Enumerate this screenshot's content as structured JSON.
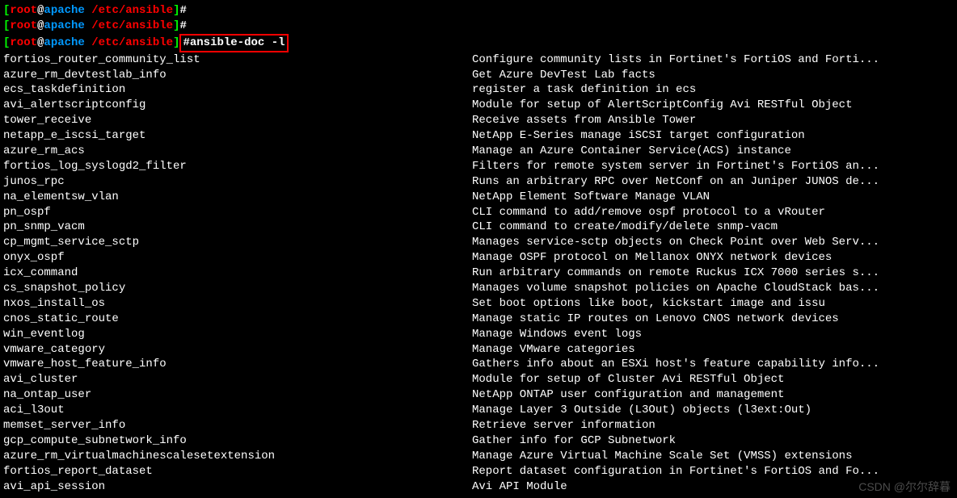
{
  "prompt": {
    "bracket_open": "[",
    "user": "root",
    "at": "@",
    "host": "apache",
    "path": " /etc/ansible",
    "bracket_close": "]",
    "hash": "#"
  },
  "command": "ansible-doc -l",
  "modules": [
    {
      "name": "fortios_router_community_list",
      "desc": "Configure community lists in Fortinet's FortiOS and Forti..."
    },
    {
      "name": "azure_rm_devtestlab_info",
      "desc": "Get Azure DevTest Lab facts"
    },
    {
      "name": "ecs_taskdefinition",
      "desc": "register a task definition in ecs"
    },
    {
      "name": "avi_alertscriptconfig",
      "desc": "Module for setup of AlertScriptConfig Avi RESTful Object"
    },
    {
      "name": "tower_receive",
      "desc": "Receive assets from Ansible Tower"
    },
    {
      "name": "netapp_e_iscsi_target",
      "desc": "NetApp E-Series manage iSCSI target configuration"
    },
    {
      "name": "azure_rm_acs",
      "desc": "Manage an Azure Container Service(ACS) instance"
    },
    {
      "name": "fortios_log_syslogd2_filter",
      "desc": "Filters for remote system server in Fortinet's FortiOS an..."
    },
    {
      "name": "junos_rpc",
      "desc": "Runs an arbitrary RPC over NetConf on an Juniper JUNOS de..."
    },
    {
      "name": "na_elementsw_vlan",
      "desc": "NetApp Element Software Manage VLAN"
    },
    {
      "name": "pn_ospf",
      "desc": "CLI command to add/remove ospf protocol to a vRouter"
    },
    {
      "name": "pn_snmp_vacm",
      "desc": "CLI command to create/modify/delete snmp-vacm"
    },
    {
      "name": "cp_mgmt_service_sctp",
      "desc": "Manages service-sctp objects on Check Point over Web Serv..."
    },
    {
      "name": "onyx_ospf",
      "desc": "Manage OSPF protocol on Mellanox ONYX network devices"
    },
    {
      "name": "icx_command",
      "desc": "Run arbitrary commands on remote Ruckus ICX 7000 series s..."
    },
    {
      "name": "cs_snapshot_policy",
      "desc": "Manages volume snapshot policies on Apache CloudStack bas..."
    },
    {
      "name": "nxos_install_os",
      "desc": "Set boot options like boot, kickstart image and issu"
    },
    {
      "name": "cnos_static_route",
      "desc": "Manage static IP routes on Lenovo CNOS network devices"
    },
    {
      "name": "win_eventlog",
      "desc": "Manage Windows event logs"
    },
    {
      "name": "vmware_category",
      "desc": "Manage VMware categories"
    },
    {
      "name": "vmware_host_feature_info",
      "desc": "Gathers info about an ESXi host's feature capability info..."
    },
    {
      "name": "avi_cluster",
      "desc": "Module for setup of Cluster Avi RESTful Object"
    },
    {
      "name": "na_ontap_user",
      "desc": "NetApp ONTAP user configuration and management"
    },
    {
      "name": "aci_l3out",
      "desc": "Manage Layer 3 Outside (L3Out) objects (l3ext:Out)"
    },
    {
      "name": "memset_server_info",
      "desc": "Retrieve server information"
    },
    {
      "name": "gcp_compute_subnetwork_info",
      "desc": "Gather info for GCP Subnetwork"
    },
    {
      "name": "azure_rm_virtualmachinescalesetextension",
      "desc": "Manage Azure Virtual Machine Scale Set (VMSS) extensions"
    },
    {
      "name": "fortios_report_dataset",
      "desc": "Report dataset configuration in Fortinet's FortiOS and Fo..."
    },
    {
      "name": "avi_api_session",
      "desc": "Avi API Module"
    }
  ],
  "watermark": "CSDN @尔尔辞暮"
}
